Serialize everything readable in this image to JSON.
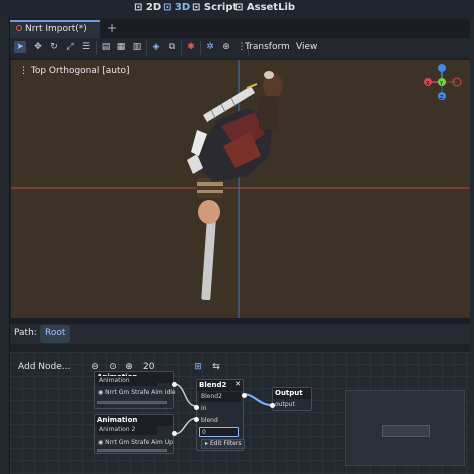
{
  "top_modes": {
    "mode_2d": "2D",
    "mode_3d": "3D",
    "mode_script": "Script",
    "mode_assetlib": "AssetLib"
  },
  "scene_tab": {
    "label": "Nrrt Import(*)",
    "add": "+"
  },
  "toolbar": {
    "icons": [
      "select-icon",
      "move-icon",
      "rotate-icon",
      "scale-icon",
      "list-select-icon",
      "lock-icon",
      "group-icon",
      "local-space-icon",
      "snap-icon",
      "camera-icon",
      "sun-icon",
      "environment-icon",
      "gizmos-icon",
      "more-icon"
    ],
    "transform_menu": "Transform",
    "view_menu": "View"
  },
  "viewport": {
    "label": "Top Orthogonal [auto]",
    "gizmo_axes": [
      "X",
      "Y",
      "Z"
    ],
    "colors": {
      "ground": "#3d3226",
      "x_axis": "#e0454d",
      "y_axis": "#7cd14a",
      "z_axis": "#3f8ae6"
    }
  },
  "path_bar": {
    "label": "Path:",
    "root": "Root"
  },
  "graph": {
    "add_node": "Add Node...",
    "zoom_value": "20",
    "nodes": {
      "animation1": {
        "title": "Animation",
        "field": "Animation",
        "clip": "Nrrt Gm Strafe Aim Idle"
      },
      "animation2": {
        "title": "Animation",
        "field": "Animation 2",
        "clip": "Nrrt Gm Strafe Aim Up"
      },
      "blend2": {
        "title": "Blend2",
        "field": "Blend2",
        "in_label": "in",
        "blend_label": "blend",
        "blend_value": "0",
        "edit_filters": "Edit Filters"
      },
      "output": {
        "title": "Output",
        "port_label": "output"
      }
    }
  }
}
